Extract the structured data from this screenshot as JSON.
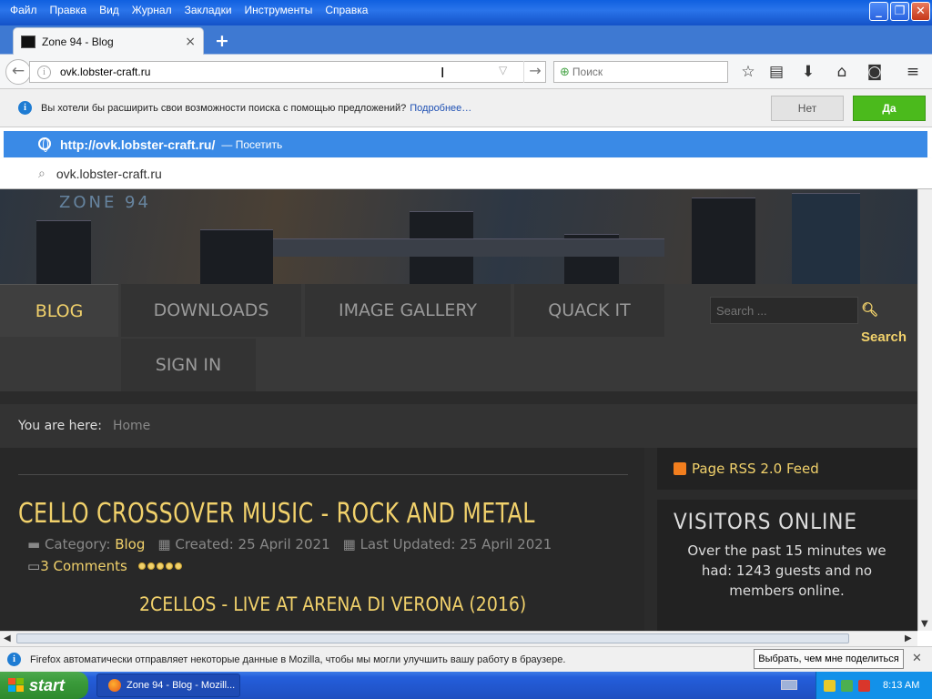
{
  "menu": [
    "Файл",
    "Правка",
    "Вид",
    "Журнал",
    "Закладки",
    "Инструменты",
    "Справка"
  ],
  "tab": {
    "title": "Zone 94 - Blog",
    "close": "×"
  },
  "newtab_symbol": "+",
  "url": {
    "value": "ovk.lobster-craft.ru"
  },
  "search": {
    "placeholder": "Поиск"
  },
  "notification": {
    "text": "Вы хотели бы расширить свои возможности поиска с помощью предложений?",
    "link": "Подробнее…",
    "no": "Нет",
    "yes": "Да"
  },
  "autocomplete": {
    "row1_url": "http://ovk.lobster-craft.ru/",
    "row1_action": "— Посетить",
    "row2_text": "ovk.lobster-craft.ru"
  },
  "site": {
    "logo": "ZONE 94",
    "nav": [
      "BLOG",
      "DOWNLOADS",
      "IMAGE GALLERY",
      "QUACK IT",
      "SIGN IN"
    ],
    "search_placeholder": "Search ...",
    "search_button": "Search",
    "breadcrumb_label": "You are here:",
    "breadcrumb_home": "Home",
    "article": {
      "title": "CELLO CROSSOVER MUSIC - ROCK AND METAL",
      "category_label": "Category:",
      "category": "Blog",
      "created": "Created: 25 April 2021",
      "updated": "Last Updated: 25 April 2021",
      "comments": "3 Comments",
      "subtitle": "2CELLOS - LIVE AT ARENA DI VERONA (2016)"
    },
    "rss": "Page RSS 2.0 Feed",
    "visitors_title": "VISITORS ONLINE",
    "visitors_text": "Over the past 15 minutes we had: 1243 guests and no members online."
  },
  "firefox_bar": {
    "text": "Firefox автоматически отправляет некоторые данные в Mozilla, чтобы мы могли улучшить вашу работу в браузере.",
    "button": "Выбрать, чем мне поделиться"
  },
  "taskbar": {
    "start": "start",
    "item": "Zone 94 - Blog - Mozill...",
    "clock": "8:13 AM"
  }
}
